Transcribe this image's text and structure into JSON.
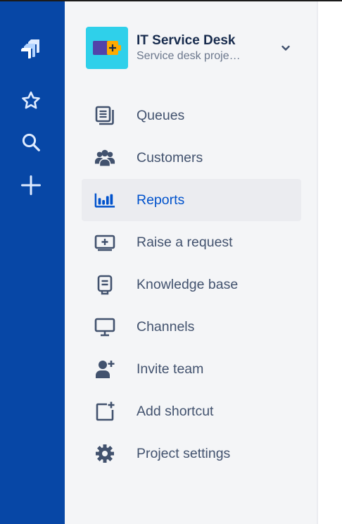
{
  "global_nav": {
    "icons": [
      "jira-logo-icon",
      "star-icon",
      "search-icon",
      "plus-icon"
    ]
  },
  "project": {
    "name": "IT Service Desk",
    "subtitle": "Service desk proje…",
    "avatar_color": "#2fd0ea"
  },
  "nav": {
    "items": [
      {
        "label": "Queues",
        "icon": "queues-icon"
      },
      {
        "label": "Customers",
        "icon": "customers-icon"
      },
      {
        "label": "Reports",
        "icon": "reports-icon",
        "active": true
      },
      {
        "label": "Raise a request",
        "icon": "raise-request-icon"
      },
      {
        "label": "Knowledge base",
        "icon": "knowledge-base-icon"
      },
      {
        "label": "Channels",
        "icon": "channels-icon"
      },
      {
        "label": "Invite team",
        "icon": "invite-team-icon"
      },
      {
        "label": "Add shortcut",
        "icon": "add-shortcut-icon"
      },
      {
        "label": "Project settings",
        "icon": "settings-icon"
      }
    ]
  },
  "colors": {
    "global_nav_bg": "#0747a6",
    "project_nav_bg": "#f4f5f7",
    "active_color": "#0052cc",
    "text_color": "#42526e"
  }
}
